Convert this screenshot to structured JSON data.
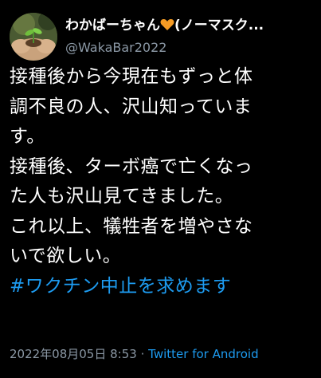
{
  "author": {
    "display_name": "わかばーちゃん",
    "display_name_tail": "(ノーマスク...",
    "handle": "@WakaBar2022",
    "avatar_icon": "avatar-hands-holding-sprout-icon",
    "heart_icon": "orange-heart-icon",
    "heart_color": "#f59b24"
  },
  "tweet": {
    "lines": [
      "接種後から今現在もずっと体",
      "調不良の人、沢山知っていま",
      "す。",
      "接種後、ターボ癌で亡くなっ",
      "た人も沢山見てきました。",
      "これ以上、犠牲者を増やさな",
      "いで欲しい。"
    ],
    "hashtag": "#ワクチン中止を求めます"
  },
  "meta": {
    "timestamp": "2022年08月05日 8:53",
    "separator": "·",
    "source": "Twitter for Android"
  },
  "colors": {
    "background": "#000000",
    "text": "#ffffff",
    "secondary": "#8b98a5",
    "link": "#1d9bf0"
  }
}
